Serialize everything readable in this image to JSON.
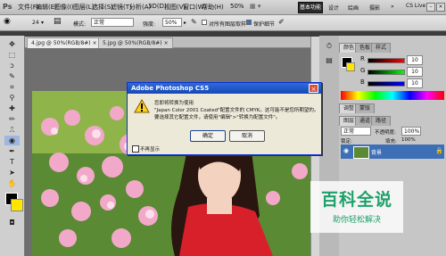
{
  "app": {
    "logo": "Ps"
  },
  "menu": {
    "items": [
      "文件(F)",
      "编辑(E)",
      "图像(I)",
      "图层(L)",
      "选择(S)",
      "滤镜(T)",
      "分析(A)",
      "3D(D)",
      "视图(V)",
      "窗口(W)",
      "帮助(H)"
    ],
    "zoom": "50%",
    "workspace_active": "基本功能",
    "workspace_links": [
      "设计",
      "绘画",
      "摄影"
    ],
    "cs_live": "CS Live"
  },
  "options": {
    "size": "24",
    "mode_label": "模式:",
    "mode_value": "正常",
    "strength_label": "强度:",
    "strength_value": "50%",
    "sample_all_label": "对所有图层取样",
    "protect_label": "保护细节"
  },
  "tabs": [
    {
      "label": "4.jpg @ 50%(RGB/8#)"
    },
    {
      "label": "5.jpg @ 50%(RGB/8#)"
    }
  ],
  "panels": {
    "color_tabs": [
      "颜色",
      "色板",
      "样式"
    ],
    "sliders": [
      {
        "letter": "R",
        "value": "10",
        "color": "#ff4d4d"
      },
      {
        "letter": "G",
        "value": "10",
        "color": "#4ddb4d"
      },
      {
        "letter": "B",
        "value": "10",
        "color": "#4d6bff"
      }
    ],
    "adjust_tabs": [
      "调整",
      "蒙版"
    ],
    "layer_tabs": [
      "图层",
      "通道",
      "路径"
    ],
    "layer_name": "背景",
    "blend_mode": "正常",
    "opacity_label": "不透明度:",
    "opacity_value": "100%",
    "lock_label": "锁定:",
    "fill_label": "填充:",
    "fill_value": "100%"
  },
  "dialog": {
    "title": "Adobe Photoshop CS5",
    "lines": [
      "您即将转换为使用",
      "\"Japan Color 2001 Coated\"配置文件的 CMYK。这可能不是您所期望的。",
      "要选择其它配置文件，请使用\"编辑\">\"转换为配置文件\"。"
    ],
    "ok": "确定",
    "cancel": "取消",
    "dont_show": "不再显示"
  },
  "watermark": {
    "title": "百科全说",
    "subtitle": "助你轻松解决"
  }
}
